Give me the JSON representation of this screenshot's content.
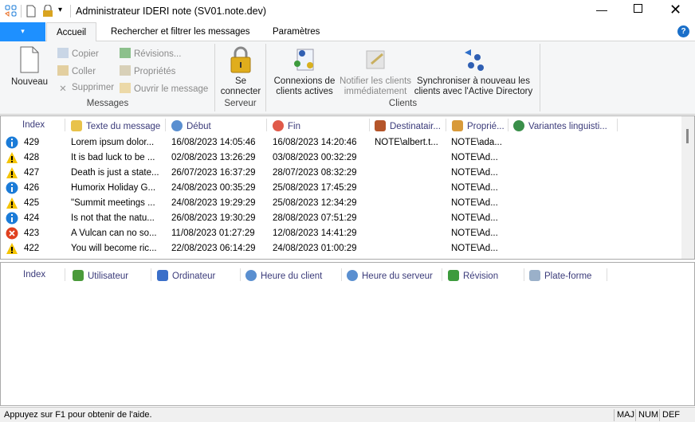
{
  "window": {
    "title": "Administrateur IDERI note (SV01.note.dev)",
    "controls": [
      "minimize",
      "maximize",
      "close"
    ]
  },
  "quick_access": [
    "app-icon",
    "new-document-icon",
    "lock-icon",
    "customize-dropdown-icon"
  ],
  "file_menu": "▾",
  "tabs": [
    {
      "label": "Accueil",
      "active": true
    },
    {
      "label": "Rechercher et filtrer les messages"
    },
    {
      "label": "Paramètres"
    }
  ],
  "help_icon": "?",
  "ribbon": {
    "messages": {
      "group": "Messages",
      "nouveau": "Nouveau",
      "copier": "Copier",
      "coller": "Coller",
      "supprimer": "Supprimer",
      "revisions": "Révisions...",
      "proprietes": "Propriétés",
      "ouvrir": "Ouvrir le message"
    },
    "serveur": {
      "group": "Serveur",
      "se_connecter_1": "Se",
      "se_connecter_2": "connecter"
    },
    "clients": {
      "group": "Clients",
      "connexions_1": "Connexions de",
      "connexions_2": "clients actives",
      "notifier_1": "Notifier les clients",
      "notifier_2": "immédiatement",
      "sync_1": "Synchroniser à nouveau les",
      "sync_2": "clients avec l'Active Directory"
    }
  },
  "messages_table": {
    "columns": [
      "Index",
      "Texte du message",
      "Début",
      "Fin",
      "Destinatair...",
      "Proprié...",
      "Variantes linguisti..."
    ],
    "rows": [
      {
        "status": "info",
        "index": "429",
        "text": "Lorem ipsum dolor...",
        "start": "16/08/2023 14:05:46",
        "end": "16/08/2023 14:20:46",
        "recipient": "NOTE\\albert.t...",
        "owner": "NOTE\\ada..."
      },
      {
        "status": "warning",
        "index": "428",
        "text": "It is bad luck to be ...",
        "start": "02/08/2023 13:26:29",
        "end": "03/08/2023 00:32:29",
        "recipient": "",
        "owner": "NOTE\\Ad..."
      },
      {
        "status": "warning",
        "index": "427",
        "text": "Death is just a state...",
        "start": "26/07/2023 16:37:29",
        "end": "28/07/2023 08:32:29",
        "recipient": "",
        "owner": "NOTE\\Ad..."
      },
      {
        "status": "info",
        "index": "426",
        "text": "Humorix Holiday G...",
        "start": "24/08/2023 00:35:29",
        "end": "25/08/2023 17:45:29",
        "recipient": "",
        "owner": "NOTE\\Ad..."
      },
      {
        "status": "warning",
        "index": "425",
        "text": "\"Summit meetings ...",
        "start": "24/08/2023 19:29:29",
        "end": "25/08/2023 12:34:29",
        "recipient": "",
        "owner": "NOTE\\Ad..."
      },
      {
        "status": "info",
        "index": "424",
        "text": "Is not that the natu...",
        "start": "26/08/2023 19:30:29",
        "end": "28/08/2023 07:51:29",
        "recipient": "",
        "owner": "NOTE\\Ad..."
      },
      {
        "status": "error",
        "index": "423",
        "text": "A Vulcan can no so...",
        "start": "11/08/2023 01:27:29",
        "end": "12/08/2023 14:41:29",
        "recipient": "",
        "owner": "NOTE\\Ad..."
      },
      {
        "status": "warning",
        "index": "422",
        "text": "You will become ric...",
        "start": "22/08/2023 06:14:29",
        "end": "24/08/2023 01:00:29",
        "recipient": "",
        "owner": "NOTE\\Ad..."
      }
    ]
  },
  "connections_table": {
    "columns": [
      "Index",
      "Utilisateur",
      "Ordinateur",
      "Heure du client",
      "Heure du serveur",
      "Révision",
      "Plate-forme"
    ]
  },
  "status_bar": {
    "text": "Appuyez sur F1 pour obtenir de l'aide.",
    "indicators": [
      "MAJ",
      "NUM",
      "DEF"
    ]
  },
  "colors": {
    "accent": "#1e90ff",
    "info": "#1a7bd8",
    "warning": "#f5c400",
    "error": "#e0401f",
    "header_text": "#3b3b7a"
  }
}
